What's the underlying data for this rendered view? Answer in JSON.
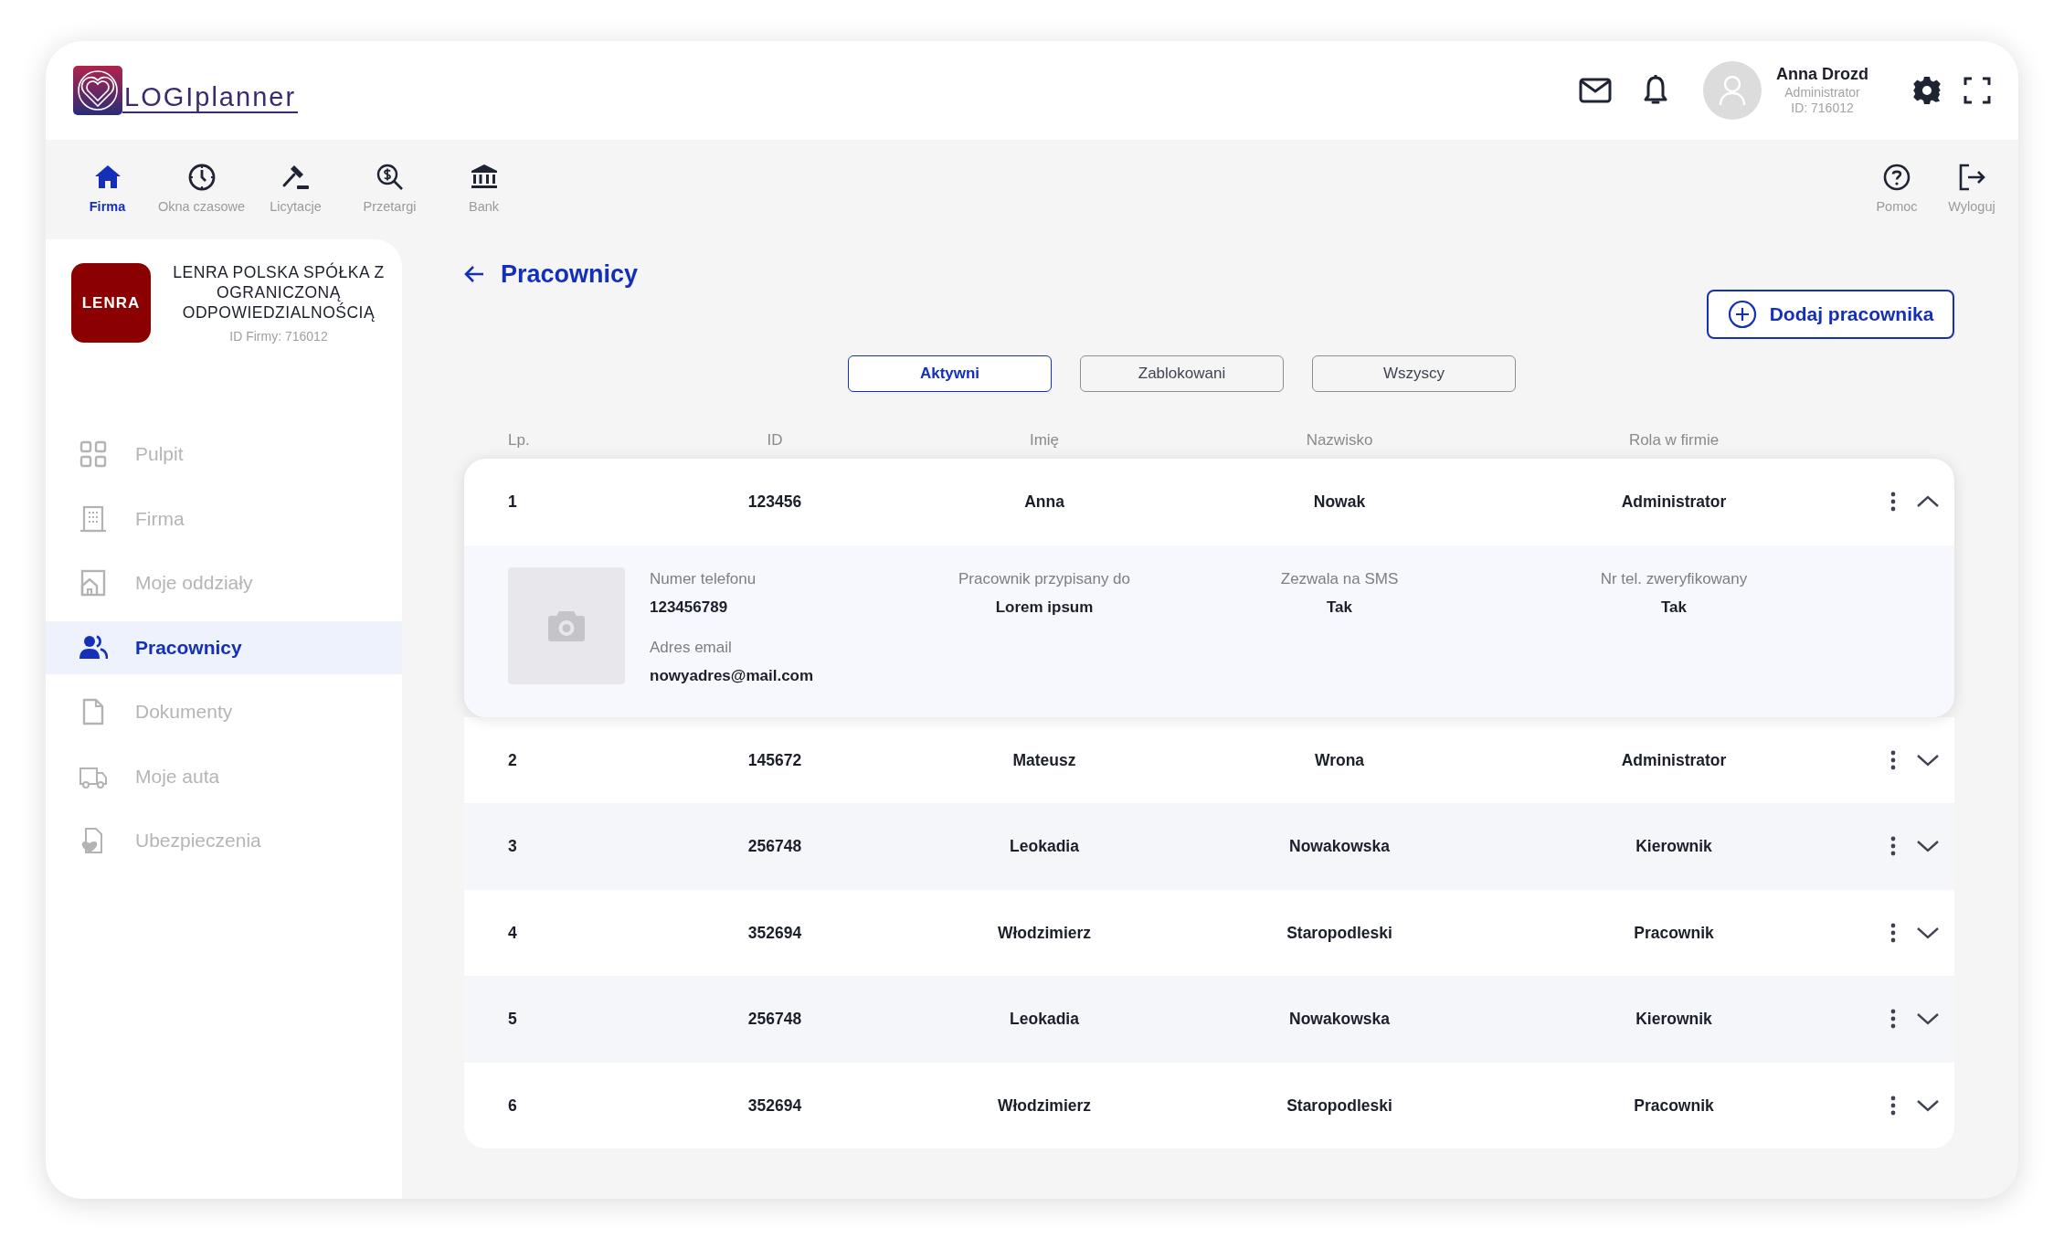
{
  "logo": {
    "text": "LOGIplanner"
  },
  "user": {
    "name": "Anna Drozd",
    "role": "Administrator",
    "id": "ID: 716012"
  },
  "top_nav": [
    {
      "label": "Firma",
      "selected": true
    },
    {
      "label": "Okna czasowe",
      "selected": false
    },
    {
      "label": "Licytacje",
      "selected": false
    },
    {
      "label": "Przetargi",
      "selected": false
    },
    {
      "label": "Bank",
      "selected": false
    }
  ],
  "top_nav_right": [
    {
      "label": "Pomoc"
    },
    {
      "label": "Wyloguj"
    }
  ],
  "company": {
    "logo_text": "LENRA",
    "name": "LENRA POLSKA SPÓŁKA Z OGRANICZONĄ ODPOWIEDZIALNOŚCIĄ",
    "id": "ID Firmy: 716012"
  },
  "sidebar": {
    "items": [
      {
        "label": "Pulpit",
        "selected": false
      },
      {
        "label": "Firma",
        "selected": false
      },
      {
        "label": "Moje oddziały",
        "selected": false
      },
      {
        "label": "Pracownicy",
        "selected": true
      },
      {
        "label": "Dokumenty",
        "selected": false
      },
      {
        "label": "Moje auta",
        "selected": false
      },
      {
        "label": "Ubezpieczenia",
        "selected": false
      }
    ]
  },
  "page": {
    "title": "Pracownicy",
    "add_button": "Dodaj pracownika"
  },
  "filters": [
    {
      "label": "Aktywni",
      "selected": true
    },
    {
      "label": "Zablokowani",
      "selected": false
    },
    {
      "label": "Wszyscy",
      "selected": false
    }
  ],
  "table": {
    "columns": [
      "Lp.",
      "ID",
      "Imię",
      "Nazwisko",
      "Rola w firmie"
    ],
    "rows": [
      {
        "cells": [
          "1",
          "123456",
          "Anna",
          "Nowak",
          "Administrator"
        ],
        "expanded": true,
        "details": [
          {
            "label": "Numer telefonu",
            "value": "123456789"
          },
          {
            "label": "Adres email",
            "value": "nowyadres@mail.com"
          },
          {
            "label": "Pracownik przypisany do",
            "value": "Lorem ipsum"
          },
          {
            "label": "Zezwala na SMS",
            "value": "Tak"
          },
          {
            "label": "Nr tel. zweryfikowany",
            "value": "Tak"
          }
        ]
      },
      {
        "cells": [
          "2",
          "145672",
          "Mateusz",
          "Wrona",
          "Administrator"
        ],
        "expanded": false
      },
      {
        "cells": [
          "3",
          "256748",
          "Leokadia",
          "Nowakowska",
          "Kierownik"
        ],
        "expanded": false
      },
      {
        "cells": [
          "4",
          "352694",
          "Włodzimierz",
          "Staropodleski",
          "Pracownik"
        ],
        "expanded": false
      },
      {
        "cells": [
          "5",
          "256748",
          "Leokadia",
          "Nowakowska",
          "Kierownik"
        ],
        "expanded": false
      },
      {
        "cells": [
          "6",
          "352694",
          "Włodzimierz",
          "Staropodleski",
          "Pracownik"
        ],
        "expanded": false
      }
    ]
  }
}
